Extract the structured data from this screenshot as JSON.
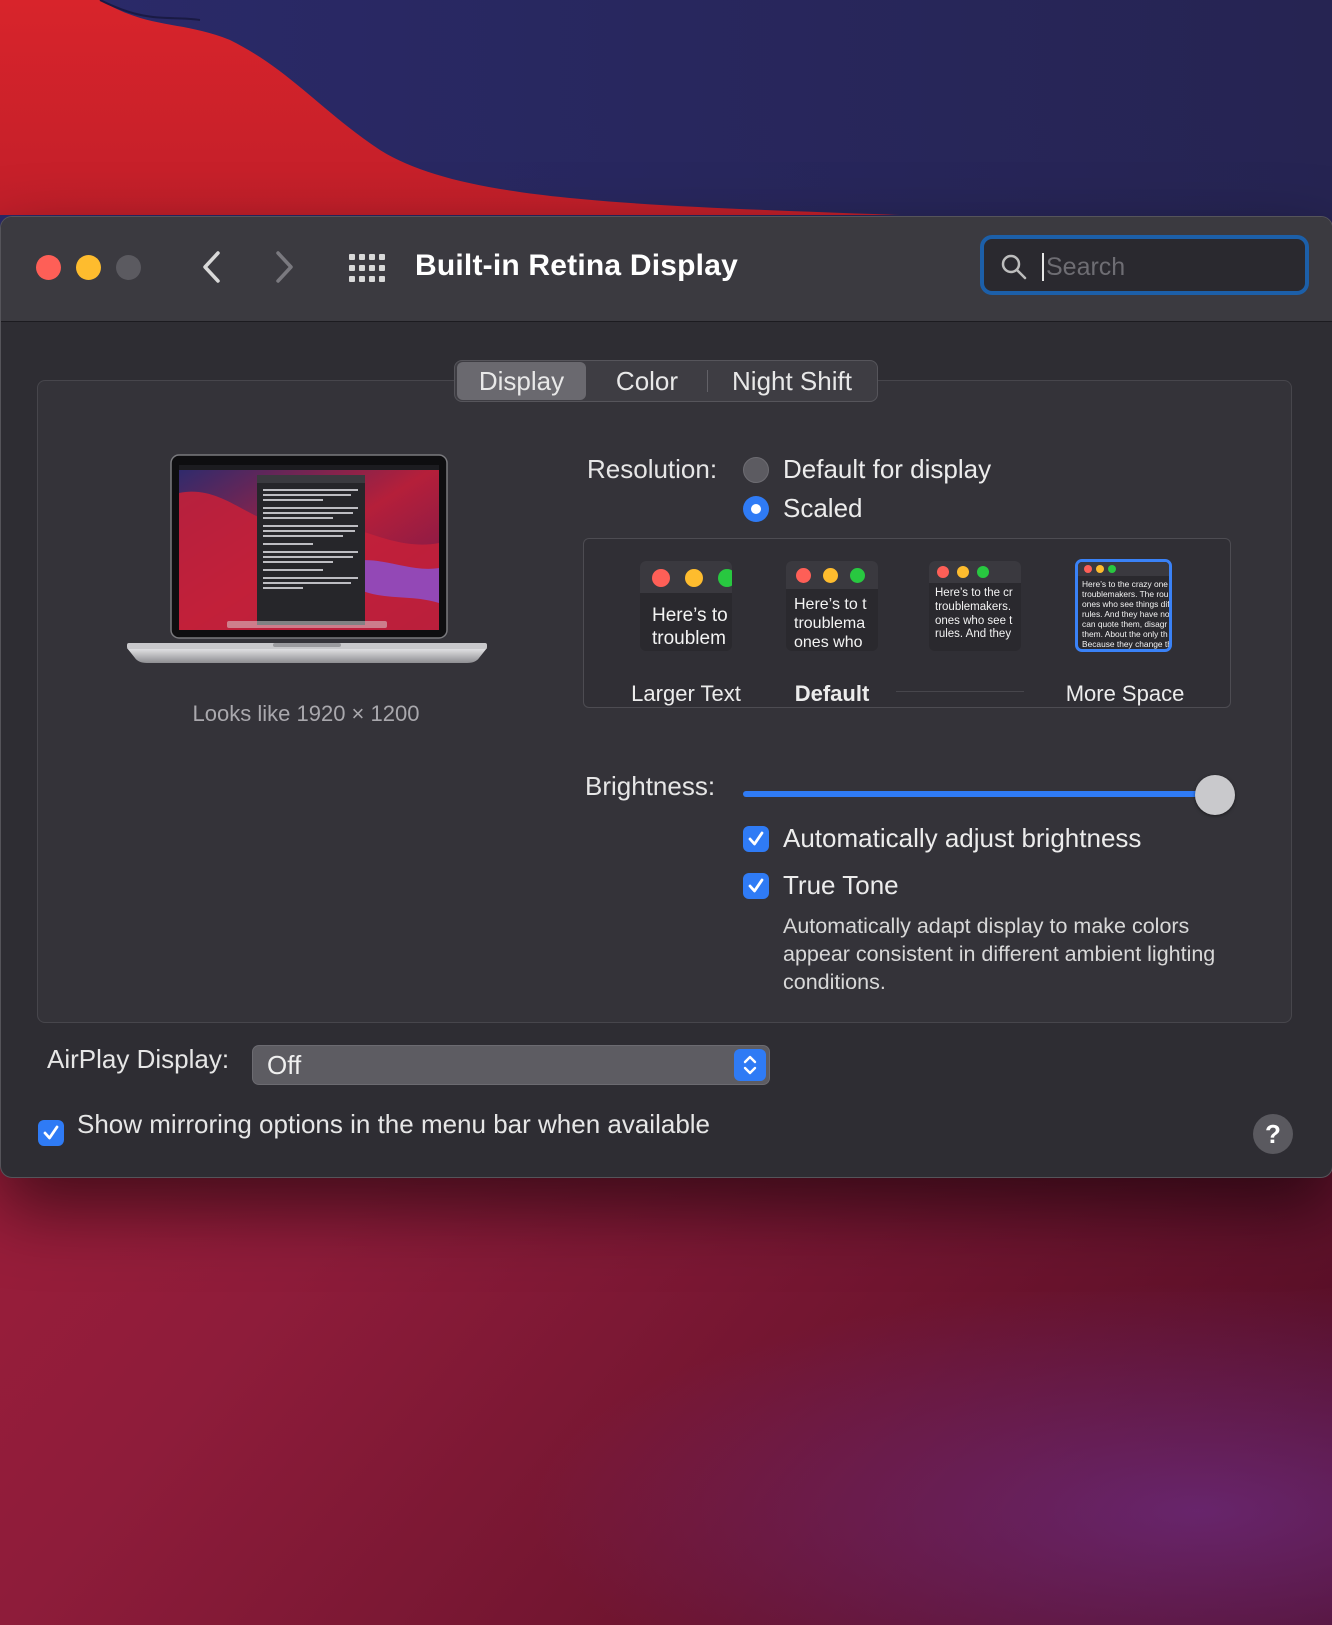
{
  "window": {
    "title": "Built-in Retina Display",
    "search_placeholder": "Search"
  },
  "tabs": [
    {
      "label": "Display",
      "selected": true
    },
    {
      "label": "Color",
      "selected": false
    },
    {
      "label": "Night Shift",
      "selected": false
    }
  ],
  "preview": {
    "looks_like": "Looks like 1920 × 1200"
  },
  "resolution": {
    "label": "Resolution:",
    "options": [
      {
        "label": "Default for display",
        "selected": false
      },
      {
        "label": "Scaled",
        "selected": true
      }
    ],
    "scale_labels": {
      "larger": "Larger Text",
      "default": "Default",
      "more": "More Space"
    },
    "thumbnails": [
      {
        "text": "Here’s to\ntroublem"
      },
      {
        "text": "Here’s to t\ntroublema\nones who"
      },
      {
        "text": "Here’s to the cr\ntroublemakers.\nones who see t\nrules. And they"
      },
      {
        "text": "Here’s to the crazy one\ntroublemakers. The rou\nones who see things dif\nrules. And they have no\ncan quote them, disagr\nthem. About the only th\nBecause they change th"
      }
    ]
  },
  "brightness": {
    "label": "Brightness:",
    "level_percent": 100,
    "auto_adjust_label": "Automatically adjust brightness",
    "auto_adjust_checked": true,
    "true_tone_label": "True Tone",
    "true_tone_checked": true,
    "true_tone_description": "Automatically adapt display to make colors appear consistent in different ambient lighting conditions."
  },
  "airplay": {
    "label": "AirPlay Display:",
    "value": "Off"
  },
  "mirroring": {
    "label": "Show mirroring options in the menu bar when available",
    "checked": true
  },
  "help": "?",
  "colors": {
    "accent": "#2f7bf5",
    "close": "#fe5f57",
    "minimize": "#febc2e"
  }
}
